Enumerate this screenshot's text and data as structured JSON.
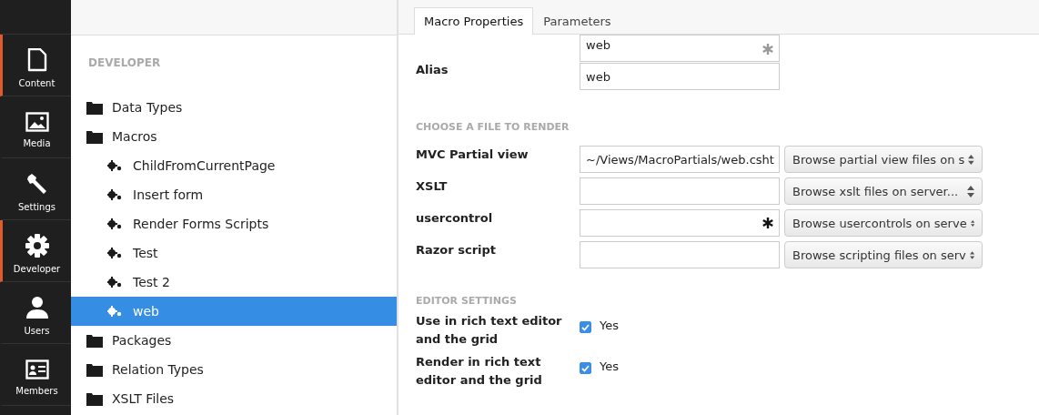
{
  "nav": [
    {
      "label": "Content",
      "selected": true
    },
    {
      "label": "Media",
      "selected": false
    },
    {
      "label": "Settings",
      "selected": false
    },
    {
      "label": "Developer",
      "selected": true
    },
    {
      "label": "Users",
      "selected": false
    },
    {
      "label": "Members",
      "selected": false
    }
  ],
  "tree": {
    "heading": "DEVELOPER",
    "items": [
      {
        "label": "Data Types",
        "kind": "folder",
        "selected": false
      },
      {
        "label": "Macros",
        "kind": "folder",
        "selected": false,
        "children": [
          {
            "label": "ChildFromCurrentPage",
            "kind": "macro",
            "selected": false
          },
          {
            "label": "Insert form",
            "kind": "macro",
            "selected": false
          },
          {
            "label": "Render Forms Scripts",
            "kind": "macro",
            "selected": false
          },
          {
            "label": "Test",
            "kind": "macro",
            "selected": false
          },
          {
            "label": "Test 2",
            "kind": "macro",
            "selected": false
          },
          {
            "label": "web",
            "kind": "macro",
            "selected": true
          }
        ]
      },
      {
        "label": "Packages",
        "kind": "folder",
        "selected": false
      },
      {
        "label": "Relation Types",
        "kind": "folder",
        "selected": false
      },
      {
        "label": "XSLT Files",
        "kind": "folder",
        "selected": false
      }
    ]
  },
  "tabs": [
    {
      "label": "Macro Properties",
      "selected": true
    },
    {
      "label": "Parameters",
      "selected": false
    }
  ],
  "name_field": {
    "value": "web",
    "required": true
  },
  "alias": {
    "label": "Alias",
    "value": "web"
  },
  "file_section": {
    "heading": "CHOOSE A FILE TO RENDER",
    "rows": [
      {
        "label": "MVC Partial view",
        "value": "~/Views/MacroPartials/web.csht",
        "required": false,
        "browse": "Browse partial view files on s"
      },
      {
        "label": "XSLT",
        "required": false,
        "browse": "Browse xslt files on server..."
      },
      {
        "label": "usercontrol",
        "required": true,
        "browse": "Browse usercontrols on serve"
      },
      {
        "label": "Razor script",
        "required": false,
        "browse": "Browse scripting files on serv"
      }
    ]
  },
  "editor_section": {
    "heading": "EDITOR SETTINGS",
    "rows": [
      {
        "label": "Use in rich text editor and the grid",
        "checked": true,
        "option": "Yes"
      },
      {
        "label": "Render in rich text editor and the grid",
        "checked": true,
        "option": "Yes"
      }
    ]
  }
}
